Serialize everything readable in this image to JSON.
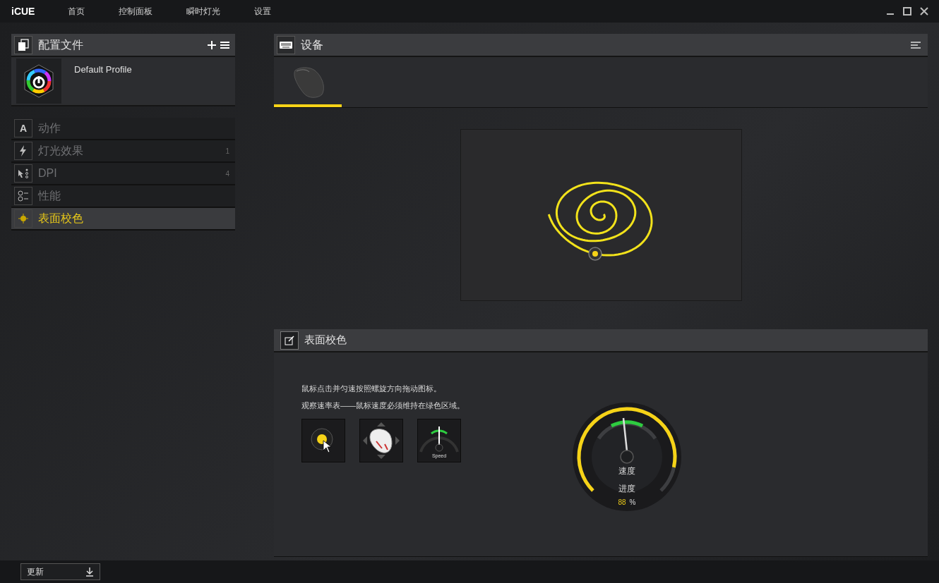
{
  "app": {
    "logo": "iCUE"
  },
  "nav": [
    {
      "label": "首页"
    },
    {
      "label": "控制面板"
    },
    {
      "label": "瞬时灯光"
    },
    {
      "label": "设置"
    }
  ],
  "profiles": {
    "title": "配置文件",
    "items": [
      {
        "name": "Default Profile"
      }
    ]
  },
  "menu": [
    {
      "kind": "actions",
      "glyph": "A",
      "label": "动作",
      "selected": false
    },
    {
      "kind": "lighting",
      "label": "灯光效果",
      "count": "1",
      "selected": false
    },
    {
      "kind": "dpi",
      "label": "DPI",
      "count": "4",
      "selected": false
    },
    {
      "kind": "performance",
      "label": "性能",
      "selected": false
    },
    {
      "kind": "surface",
      "label": "表面校色",
      "selected": true
    }
  ],
  "devices": {
    "title": "设备",
    "tabs": [
      {
        "kind": "mouse",
        "selected": true
      }
    ]
  },
  "calibration": {
    "title": "表面校色",
    "instructions": [
      "鼠标点击并匀速按照螺旋方向拖动图标。",
      "观察速率表——鼠标速度必须维持在绿色区域。"
    ],
    "steps": [
      {
        "kind": "target"
      },
      {
        "kind": "mouse"
      },
      {
        "kind": "speed",
        "label": "Speed"
      }
    ],
    "gauge": {
      "speed_label": "速度",
      "progress_label": "进度",
      "progress_value": "88",
      "unit": "%"
    }
  },
  "footer": {
    "update_button": "更新"
  }
}
